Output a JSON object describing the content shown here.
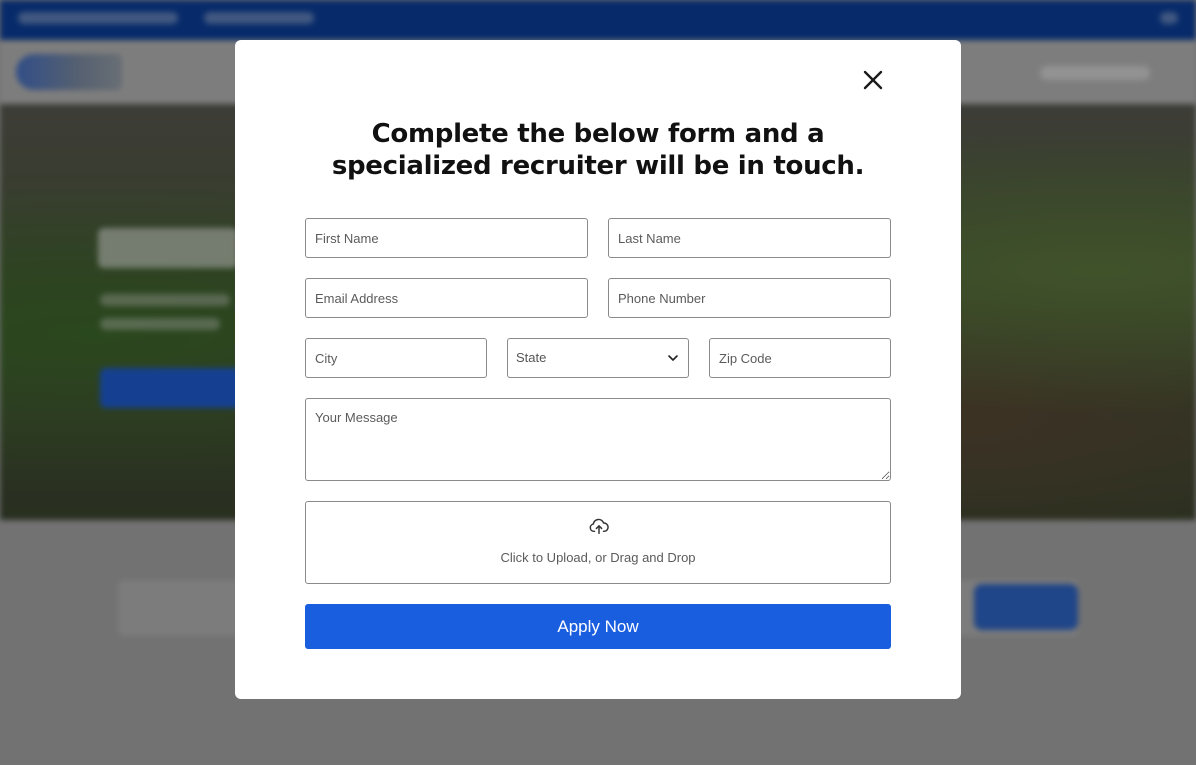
{
  "modal": {
    "title_line1": "Complete the below form and a",
    "title_line2": "specialized recruiter will be in touch.",
    "fields": {
      "first_name_placeholder": "First Name",
      "last_name_placeholder": "Last Name",
      "email_placeholder": "Email Address",
      "phone_placeholder": "Phone Number",
      "city_placeholder": "City",
      "state_value": "State",
      "zip_placeholder": "Zip Code",
      "message_placeholder": "Your Message"
    },
    "upload": {
      "icon": "upload-cloud-icon",
      "text": "Click to Upload, or Drag and Drop"
    },
    "submit_label": "Apply Now",
    "close_icon": "close-icon"
  },
  "colors": {
    "primary_button": "#1a5ee0",
    "topbar": "#0b3f9c",
    "overlay": "rgba(0,0,0,0.32)",
    "field_border": "#8a8a8a"
  }
}
